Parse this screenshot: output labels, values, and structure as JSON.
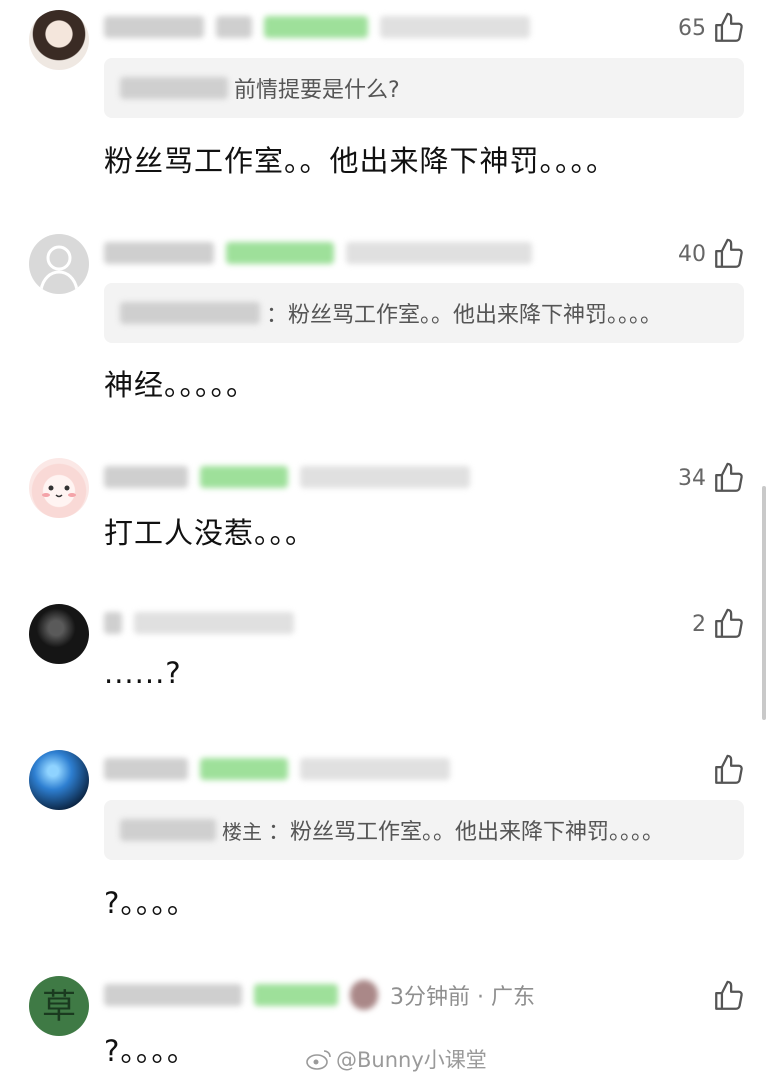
{
  "comments": [
    {
      "likes": "65",
      "quote": {
        "text": "前情提要是什么?"
      },
      "body": "粉丝骂工作室。。他出来降下神罚。。。。"
    },
    {
      "likes": "40",
      "quote": {
        "text": "：粉丝骂工作室。。他出来降下神罚。。。。"
      },
      "body": "神经。。。。。"
    },
    {
      "likes": "34",
      "body": "打工人没惹。。。"
    },
    {
      "likes": "2",
      "body": "......?"
    },
    {
      "likes": "",
      "quote": {
        "author": "楼主",
        "text": "：粉丝骂工作室。。他出来降下神罚。。。。"
      },
      "body": "?。。。。"
    },
    {
      "likes": "",
      "time_location": "3分钟前 · 广东",
      "body": "?。。。。"
    }
  ],
  "watermark": "@Bunny小课堂",
  "colors": {
    "tag_green": "#9ee09a",
    "quote_bg": "#f3f3f3",
    "like_gray": "#666666"
  },
  "icons": [
    "thumbs-up-icon",
    "weibo-icon"
  ]
}
